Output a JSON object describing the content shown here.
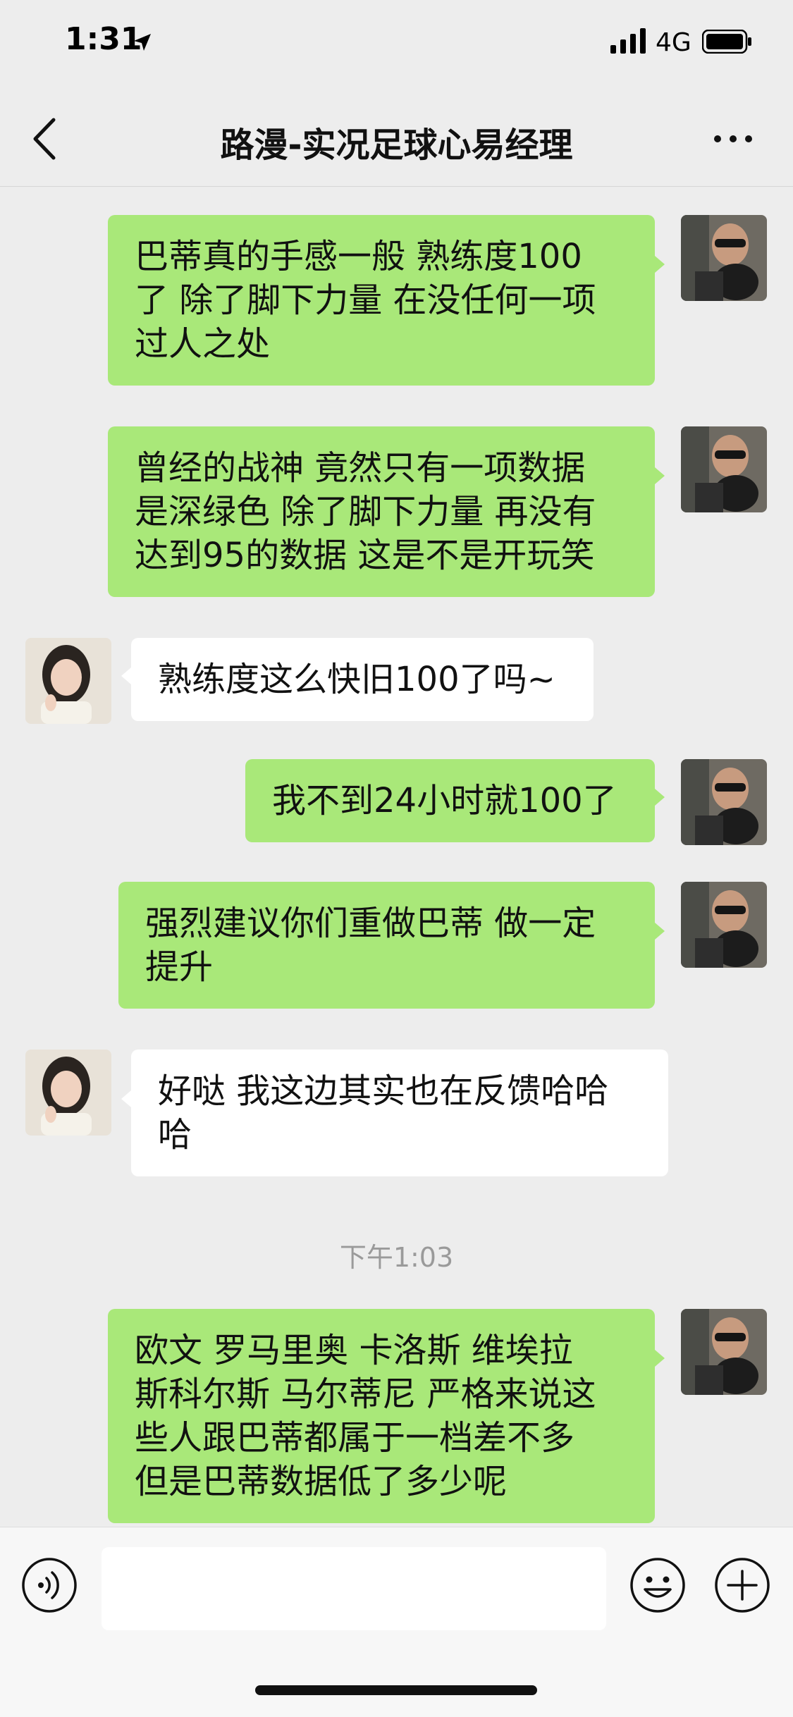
{
  "status_bar": {
    "time": "1:31",
    "network": "4G",
    "icons": [
      "location-arrow-icon",
      "signal-icon",
      "battery-icon"
    ]
  },
  "nav": {
    "title": "路漫-实况足球心易经理",
    "icons": [
      "back-chevron-icon",
      "more-dots-icon"
    ]
  },
  "messages": [
    {
      "side": "out",
      "lines": [
        "巴蒂真的手感一般 熟练度100",
        "了 除了脚下力量 在没任何一项",
        "过人之处"
      ]
    },
    {
      "side": "out",
      "lines": [
        "曾经的战神 竟然只有一项数据",
        "是深绿色 除了脚下力量 再没有",
        "达到95的数据 这是不是开玩笑"
      ]
    },
    {
      "side": "in",
      "lines": [
        "熟练度这么快旧100了吗~"
      ]
    },
    {
      "side": "out",
      "lines": [
        "我不到24小时就100了"
      ]
    },
    {
      "side": "out",
      "lines": [
        "强烈建议你们重做巴蒂 做一定",
        "提升"
      ]
    },
    {
      "side": "in",
      "lines": [
        "好哒 我这边其实也在反馈哈哈",
        "哈"
      ]
    },
    {
      "side": "out",
      "lines": [
        "欧文 罗马里奥 卡洛斯 维埃拉",
        "斯科尔斯 马尔蒂尼 严格来说这",
        "些人跟巴蒂都属于一档差不多",
        "但是巴蒂数据低了多少呢"
      ]
    }
  ],
  "timestamp": "下午1:03",
  "input_bar": {
    "text_value": "",
    "icons": [
      "voice-icon",
      "emoji-icon",
      "plus-icon"
    ]
  },
  "colors": {
    "background": "#ededed",
    "outgoing_bubble": "#a9e879",
    "incoming_bubble": "#ffffff",
    "timestamp_text": "#9a9a9a"
  }
}
